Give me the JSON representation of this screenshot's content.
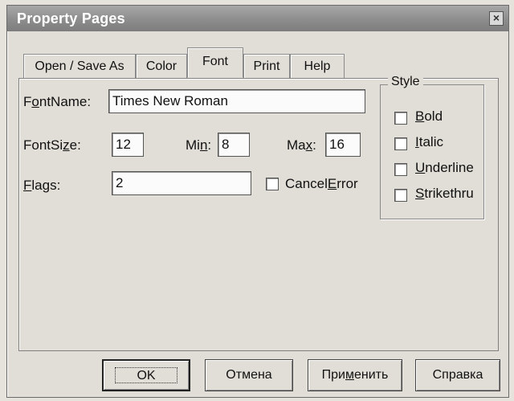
{
  "window": {
    "title": "Property Pages",
    "close_label": "×"
  },
  "tabs": [
    {
      "label": "Open / Save As",
      "active": false
    },
    {
      "label": "Color",
      "active": false
    },
    {
      "label": "Font",
      "active": true
    },
    {
      "label": "Print",
      "active": false
    },
    {
      "label": "Help",
      "active": false
    }
  ],
  "font_panel": {
    "fontname": {
      "label_pre": "F",
      "label_u": "o",
      "label_post": "ntName:",
      "value": "Times New Roman"
    },
    "fontsize": {
      "label_pre": "FontSi",
      "label_u": "z",
      "label_post": "e:",
      "value": "12"
    },
    "min": {
      "label_pre": "Mi",
      "label_u": "n",
      "label_post": ":",
      "value": "8"
    },
    "max": {
      "label_pre": "Ma",
      "label_u": "x",
      "label_post": ":",
      "value": "16"
    },
    "flags": {
      "label_pre": "",
      "label_u": "F",
      "label_post": "lags:",
      "value": "2"
    },
    "cancel_error": {
      "label_pre": "Cancel",
      "label_u": "E",
      "label_post": "rror",
      "checked": false
    }
  },
  "style_group": {
    "title": "Style",
    "options": [
      {
        "u": "B",
        "rest": "old",
        "checked": false
      },
      {
        "u": "I",
        "rest": "talic",
        "checked": false
      },
      {
        "u": "U",
        "rest": "nderline",
        "checked": false
      },
      {
        "u": "S",
        "rest": "trikethru",
        "checked": false
      }
    ]
  },
  "buttons": {
    "ok": "OK",
    "cancel": "Отмена",
    "apply_pre": "При",
    "apply_u": "м",
    "apply_post": "енить",
    "help": "Справка"
  }
}
